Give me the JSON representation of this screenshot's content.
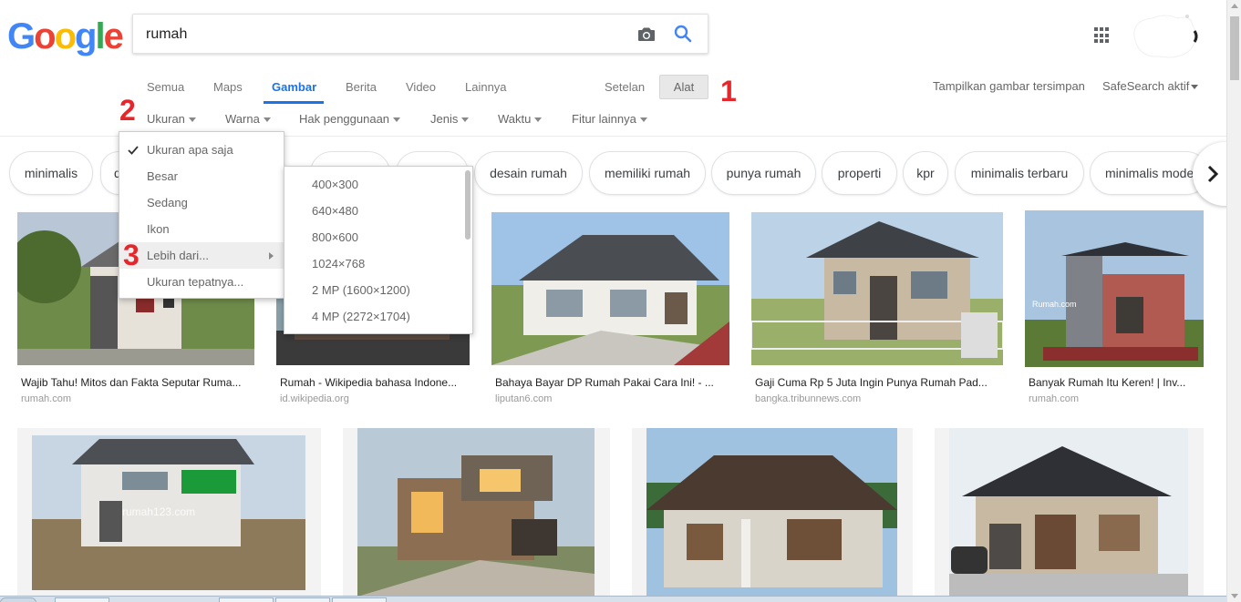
{
  "logo": {
    "letters": [
      "G",
      "o",
      "o",
      "g",
      "l",
      "e"
    ],
    "colors": [
      "#4285f4",
      "#ea4335",
      "#fbbc05",
      "#4285f4",
      "#34a853",
      "#ea4335"
    ]
  },
  "search": {
    "query": "rumah"
  },
  "tabs": [
    "Semua",
    "Maps",
    "Gambar",
    "Berita",
    "Video",
    "Lainnya"
  ],
  "active_tab": "Gambar",
  "settings_label": "Setelan",
  "tools_label": "Alat",
  "right_links": {
    "saved_images": "Tampilkan gambar tersimpan",
    "safesearch": "SafeSearch aktif"
  },
  "tools": [
    "Ukuran",
    "Warna",
    "Hak penggunaan",
    "Jenis",
    "Waktu",
    "Fitur lainnya"
  ],
  "markers": [
    "1",
    "2",
    "3"
  ],
  "chips": [
    "minimalis",
    "d",
    "desain rumah",
    "memiliki rumah",
    "punya rumah",
    "properti",
    "kpr",
    "minimalis terbaru",
    "minimalis mode"
  ],
  "size_menu": {
    "items": [
      "Ukuran apa saja",
      "Besar",
      "Sedang",
      "Ikon",
      "Lebih dari...",
      "Ukuran tepatnya..."
    ],
    "checked": "Ukuran apa saja",
    "highlighted": "Lebih dari..."
  },
  "larger_than_menu": {
    "items": [
      "400×300",
      "640×480",
      "800×600",
      "1024×768",
      "2 MP (1600×1200)",
      "4 MP (2272×1704)"
    ]
  },
  "results": [
    {
      "title": "Wajib Tahu! Mitos dan Fakta Seputar Ruma...",
      "source": "rumah.com"
    },
    {
      "title": "Rumah - Wikipedia bahasa Indone...",
      "source": "id.wikipedia.org"
    },
    {
      "title": "Bahaya Bayar DP Rumah Pakai Cara Ini! - ...",
      "source": "liputan6.com"
    },
    {
      "title": "Gaji Cuma Rp 5 Juta Ingin Punya Rumah Pad...",
      "source": "bangka.tribunnews.com"
    },
    {
      "title": "Banyak Rumah Itu Keren! | Inv...",
      "source": "rumah.com"
    }
  ],
  "watermarks": {
    "rumah123": "rumah123.com",
    "rumahcom": "Rumah.com"
  },
  "colors": {
    "accent": "#1a73e8",
    "marker": "#e5262b"
  }
}
